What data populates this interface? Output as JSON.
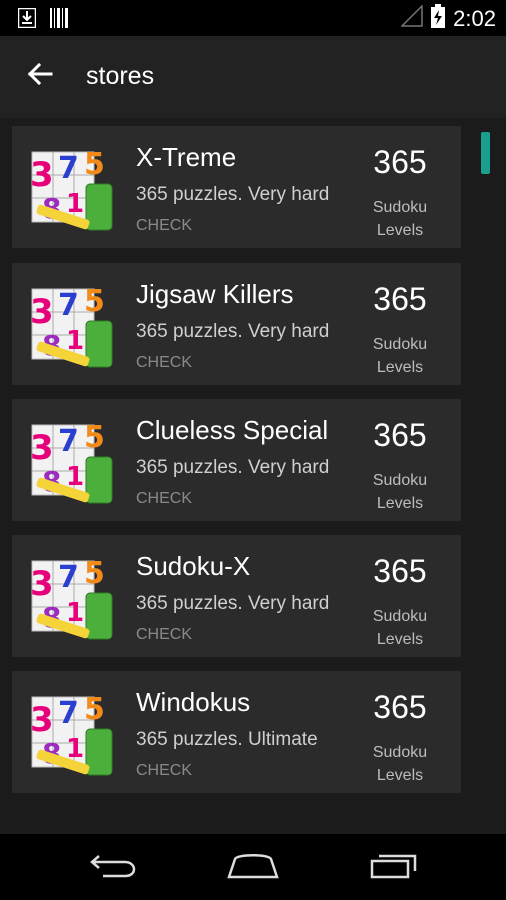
{
  "status_bar": {
    "time": "2:02"
  },
  "app_bar": {
    "title": "stores"
  },
  "colors": {
    "accent": "#1a9f8e",
    "background": "#1b1b1b",
    "card": "#2b2b2b"
  },
  "stores": [
    {
      "title": "X-Treme",
      "description": "365 puzzles. Very hard",
      "action": "CHECK",
      "count": "365",
      "unit_line1": "Sudoku",
      "unit_line2": "Levels"
    },
    {
      "title": "Jigsaw Killers",
      "description": "365 puzzles. Very hard",
      "action": "CHECK",
      "count": "365",
      "unit_line1": "Sudoku",
      "unit_line2": "Levels"
    },
    {
      "title": "Clueless Special",
      "description": "365 puzzles. Very hard",
      "action": "CHECK",
      "count": "365",
      "unit_line1": "Sudoku",
      "unit_line2": "Levels"
    },
    {
      "title": "Sudoku-X",
      "description": "365 puzzles. Very hard",
      "action": "CHECK",
      "count": "365",
      "unit_line1": "Sudoku",
      "unit_line2": "Levels"
    },
    {
      "title": "Windokus",
      "description": "365 puzzles. Ultimate",
      "action": "CHECK",
      "count": "365",
      "unit_line1": "Sudoku",
      "unit_line2": "Levels"
    }
  ],
  "icons": {
    "status_left": [
      "download-icon",
      "barcode-icon"
    ],
    "status_right": [
      "signal-icon",
      "battery-charging-icon"
    ],
    "app_bar": "back-arrow-icon",
    "card": "sudoku-app-icon",
    "nav": [
      "back-nav-icon",
      "home-nav-icon",
      "recents-nav-icon"
    ]
  }
}
